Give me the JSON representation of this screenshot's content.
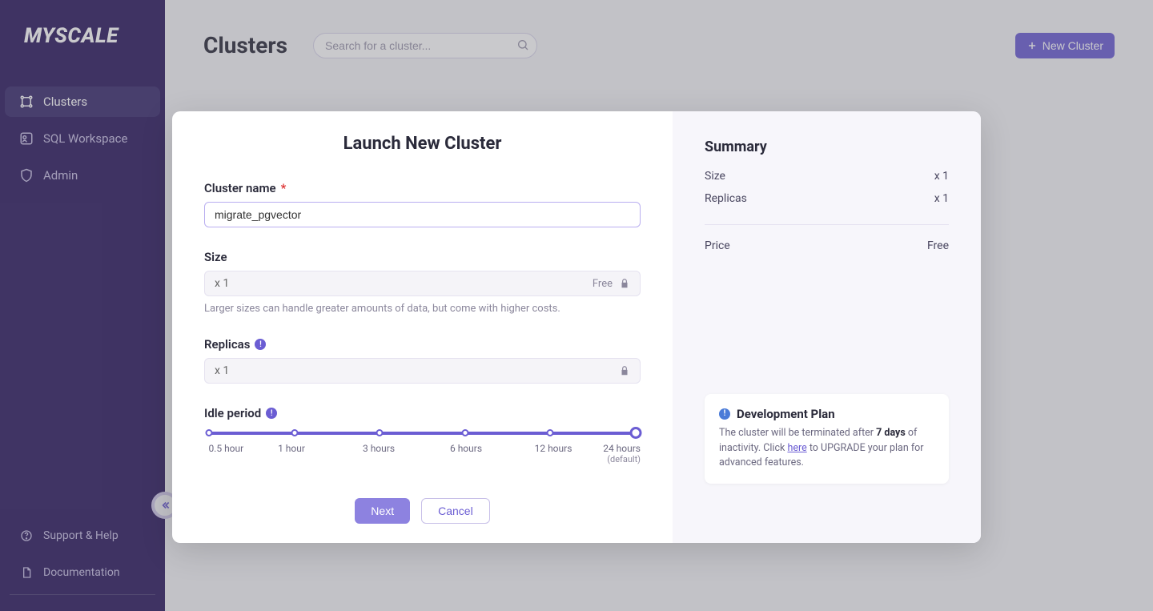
{
  "brand": "MYSCALE",
  "sidebar": {
    "items": [
      {
        "label": "Clusters",
        "icon": "clusters-icon",
        "active": true
      },
      {
        "label": "SQL Workspace",
        "icon": "sql-icon",
        "active": false
      },
      {
        "label": "Admin",
        "icon": "shield-icon",
        "active": false
      }
    ],
    "bottom": [
      {
        "label": "Support & Help",
        "icon": "help-icon"
      },
      {
        "label": "Documentation",
        "icon": "document-icon"
      }
    ]
  },
  "header": {
    "title": "Clusters",
    "search_placeholder": "Search for a cluster...",
    "new_cluster": "New Cluster"
  },
  "modal": {
    "title": "Launch New Cluster",
    "cluster_name_label": "Cluster name",
    "cluster_name_value": "migrate_pgvector",
    "size_label": "Size",
    "size_value": "x 1",
    "size_badge": "Free",
    "size_help": "Larger sizes can handle greater amounts of data, but come with higher costs.",
    "replicas_label": "Replicas",
    "replicas_value": "x 1",
    "idle_label": "Idle period",
    "slider": {
      "options": [
        "0.5 hour",
        "1 hour",
        "3 hours",
        "6 hours",
        "12 hours",
        "24 hours"
      ],
      "default_suffix": "(default)",
      "selected_index": 5
    },
    "next": "Next",
    "cancel": "Cancel"
  },
  "summary": {
    "title": "Summary",
    "size_label": "Size",
    "size_value": "x 1",
    "replicas_label": "Replicas",
    "replicas_value": "x 1",
    "price_label": "Price",
    "price_value": "Free"
  },
  "plan": {
    "title": "Development Plan",
    "text_before": "The cluster will be terminated after ",
    "days": "7 days",
    "text_after": " of inactivity. Click ",
    "link": "here",
    "text_tail": " to UPGRADE your plan for advanced features."
  }
}
